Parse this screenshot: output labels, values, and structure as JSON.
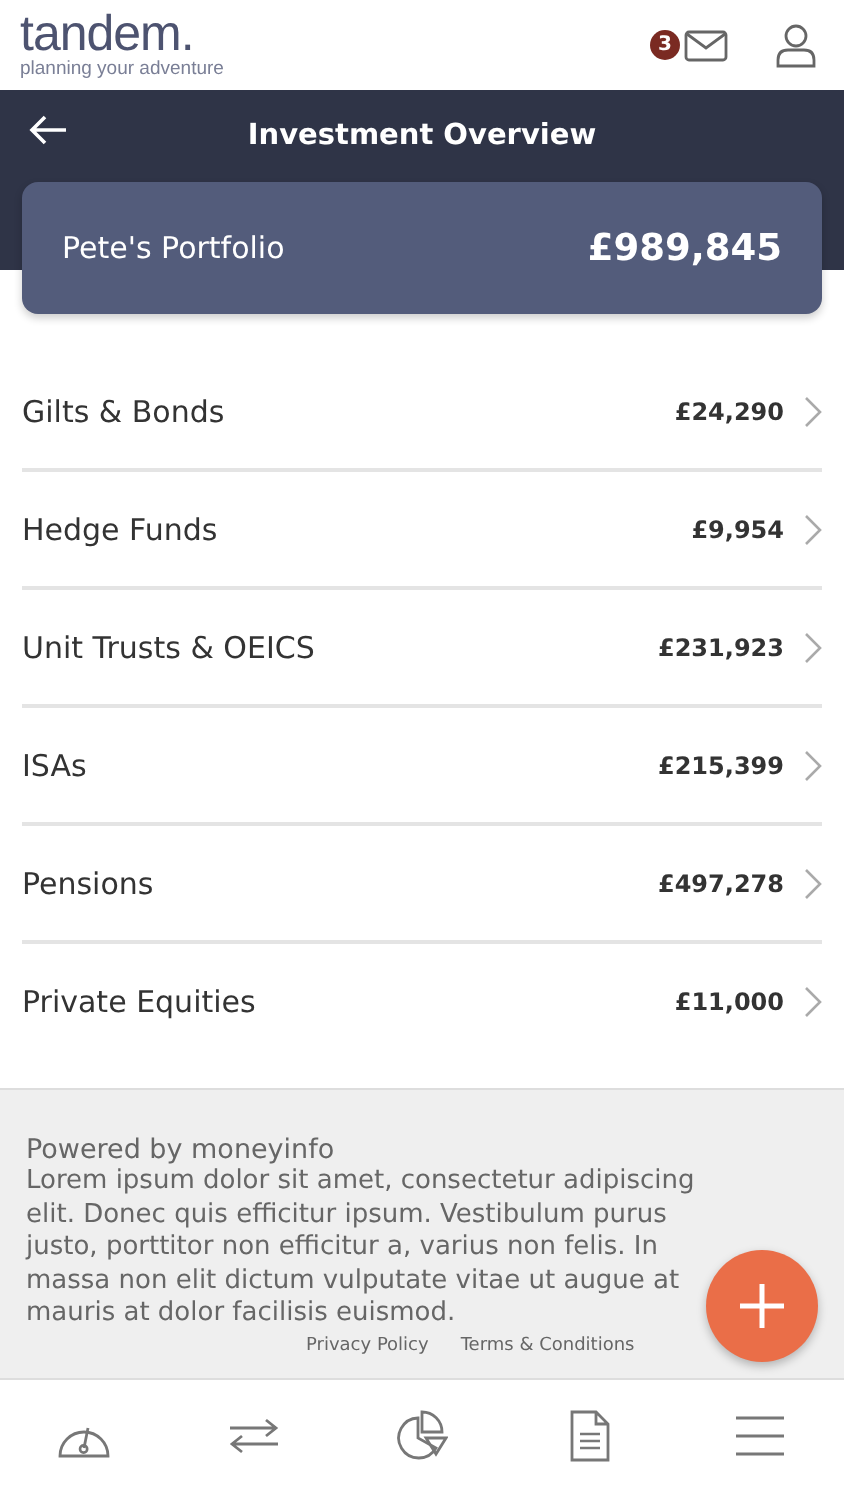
{
  "header": {
    "logo": "tandem.",
    "tagline": "planning your adventure",
    "unread_count": "3"
  },
  "title_bar": {
    "title": "Investment Overview"
  },
  "portfolio": {
    "name": "Pete's Portfolio",
    "total": "£989,845"
  },
  "holdings": [
    {
      "name": "Gilts & Bonds",
      "value": "£24,290"
    },
    {
      "name": "Hedge Funds",
      "value": "£9,954"
    },
    {
      "name": "Unit Trusts & OEICS",
      "value": "£231,923"
    },
    {
      "name": "ISAs",
      "value": "£215,399"
    },
    {
      "name": "Pensions",
      "value": "£497,278"
    },
    {
      "name": "Private Equities",
      "value": "£11,000"
    }
  ],
  "footer": {
    "powered_by": "Powered by moneyinfo",
    "text": "Lorem ipsum dolor sit amet, consectetur adipiscing elit. Donec quis efficitur ipsum. Vestibulum purus justo, porttitor non efficitur a, varius non felis. In massa non elit dictum vulputate vitae ut augue at mauris at dolor facilisis euismod.",
    "links": [
      "Privacy Policy",
      "Terms & Conditions"
    ]
  },
  "bottom_nav": [
    {
      "kind": "gauge"
    },
    {
      "kind": "transfer"
    },
    {
      "kind": "pie"
    },
    {
      "kind": "document"
    },
    {
      "kind": "menu"
    }
  ]
}
